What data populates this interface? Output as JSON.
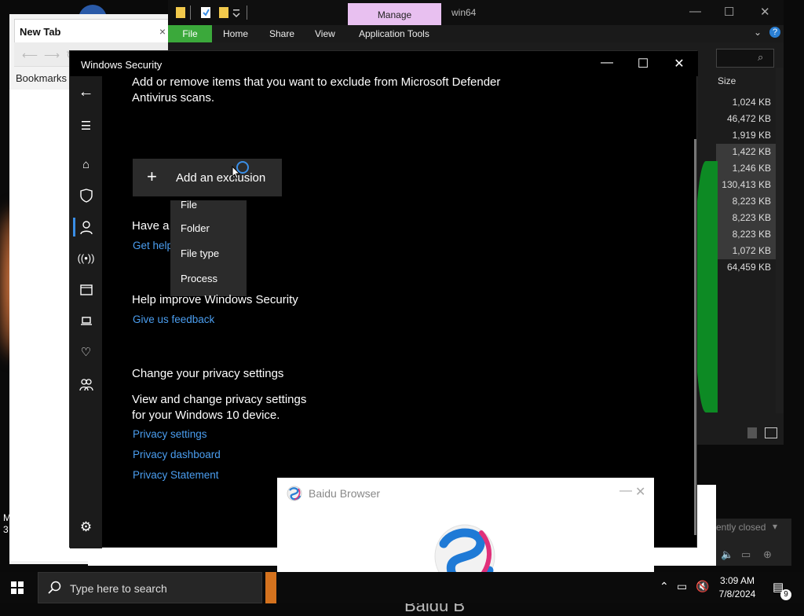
{
  "browser": {
    "tab_title": "New Tab",
    "tab_close": "×",
    "bookmarks": "Bookmarks"
  },
  "explorer": {
    "manage_tab": "Manage",
    "window_title": "win64",
    "ribbon": {
      "file": "File",
      "home": "Home",
      "share": "Share",
      "view": "View",
      "app_tools": "Application Tools"
    },
    "size_header": "Size",
    "sizes": [
      "1,024 KB",
      "46,472 KB",
      "1,919 KB",
      "1,422 KB",
      "1,246 KB",
      "130,413 KB",
      "8,223 KB",
      "8,223 KB",
      "8,223 KB",
      "1,072 KB",
      "64,459 KB"
    ]
  },
  "windows_security": {
    "title": "Windows Security",
    "exclusions_desc_line1": "Add or remove items that you want to exclude from Microsoft Defender",
    "exclusions_desc_line2": "Antivirus scans.",
    "add_exclusion": "Add an exclusion",
    "menu_items": [
      "File",
      "Folder",
      "File type",
      "Process"
    ],
    "have_question": "Have a",
    "get_help": "Get help",
    "help_improve": "Help improve Windows Security",
    "give_feedback": "Give us feedback",
    "privacy_heading": "Change your privacy settings",
    "privacy_desc_line1": "View and change privacy settings",
    "privacy_desc_line2": "for your Windows 10 device.",
    "privacy_settings": "Privacy settings",
    "privacy_dashboard": "Privacy dashboard",
    "privacy_statement": "Privacy Statement"
  },
  "baidu": {
    "title": "Baidu Browser",
    "big_text": "Baidu B"
  },
  "background_text": {
    "recently_closed": "ently closed",
    "left_edge_top": "M",
    "left_edge_bottom": "3"
  },
  "taskbar": {
    "search_placeholder": "Type here to search",
    "time": "3:09 AM",
    "date": "7/8/2024",
    "notification_count": "9"
  },
  "colors": {
    "accent": "#3a8ee6",
    "link": "#4b9ef0",
    "manage_tab": "#e8c0f0",
    "file_tab": "#3ba93b"
  }
}
